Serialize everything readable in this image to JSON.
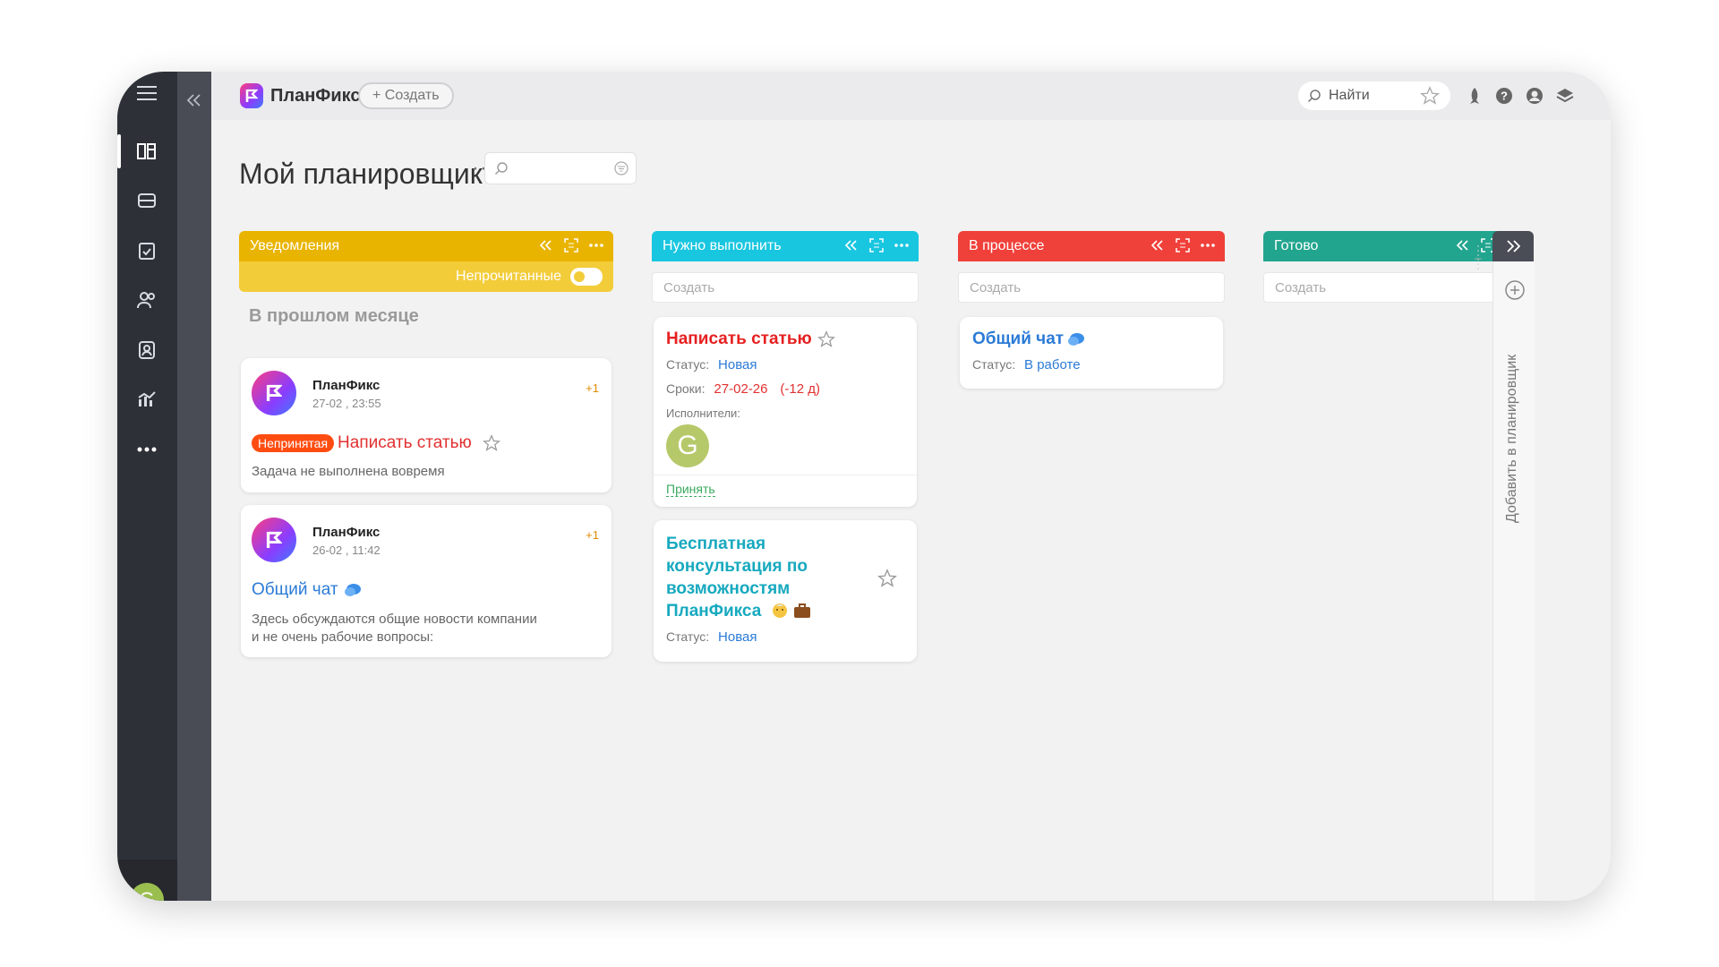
{
  "app": {
    "name": "ПланФикс"
  },
  "toolbar": {
    "create_label": "+ Создать",
    "search_placeholder": "Найти"
  },
  "sidebar": {
    "avatar_letter": "G"
  },
  "page": {
    "title": "Мой планировщик",
    "title_menu": "···"
  },
  "columns": [
    {
      "key": "notifications",
      "title": "Уведомления",
      "color": "#e9b400",
      "filter_label": "Непрочитанные",
      "section": "В прошлом месяце",
      "cards": [
        {
          "sender": "ПланФикс",
          "time": "27-02 , 23:55",
          "plus": "+1",
          "badge": "Непринятая",
          "title": "Написать статью",
          "text": "Задача не выполнена вовремя"
        },
        {
          "sender": "ПланФикс",
          "time": "26-02 , 11:42",
          "plus": "+1",
          "title": "Общий чат",
          "text": "Здесь обсуждаются общие новости компании и не очень рабочие вопросы:"
        }
      ]
    },
    {
      "key": "todo",
      "title": "Нужно выполнить",
      "color": "#19c6e0",
      "create_placeholder": "Создать",
      "cards": [
        {
          "title": "Написать статью",
          "status_label": "Статус:",
          "status": "Новая",
          "deadline_label": "Сроки:",
          "deadline": "27-02-26",
          "overdue": "(-12 д)",
          "assignees_label": "Исполнители:",
          "assignee_letter": "G",
          "action": "Принять"
        },
        {
          "title": "Бесплатная консультация по возможностям ПланФикса",
          "status_label": "Статус:",
          "status": "Новая"
        }
      ]
    },
    {
      "key": "inprogress",
      "title": "В процессе",
      "color": "#f0403a",
      "create_placeholder": "Создать",
      "cards": [
        {
          "title": "Общий чат",
          "status_label": "Статус:",
          "status": "В работе"
        }
      ]
    },
    {
      "key": "done",
      "title": "Готово",
      "color": "#22a58f",
      "create_placeholder": "Создать",
      "cards": []
    }
  ],
  "right_panel": {
    "label": "Добавить в планировщик"
  }
}
